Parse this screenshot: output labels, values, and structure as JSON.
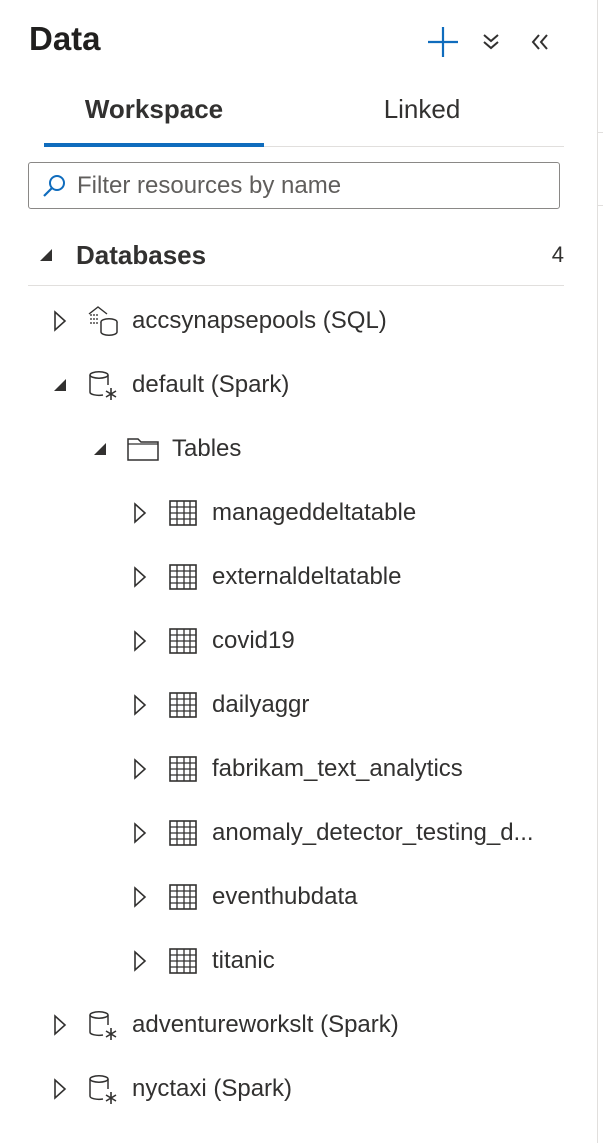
{
  "header": {
    "title": "Data"
  },
  "tabs": [
    {
      "label": "Workspace",
      "active": true
    },
    {
      "label": "Linked",
      "active": false
    }
  ],
  "search": {
    "placeholder": "Filter resources by name",
    "value": ""
  },
  "section": {
    "label": "Databases",
    "count": "4",
    "expanded": true
  },
  "tree": [
    {
      "label": "accsynapsepools (SQL)",
      "icon": "sql-pool-icon",
      "expanded": false
    },
    {
      "label": "default (Spark)",
      "icon": "spark-database-icon",
      "expanded": true
    },
    {
      "label": "Tables",
      "icon": "folder-icon",
      "expanded": true
    },
    {
      "label": "manageddeltatable",
      "icon": "table-icon",
      "expanded": false
    },
    {
      "label": "externaldeltatable",
      "icon": "table-icon",
      "expanded": false
    },
    {
      "label": "covid19",
      "icon": "table-icon",
      "expanded": false
    },
    {
      "label": "dailyaggr",
      "icon": "table-icon",
      "expanded": false
    },
    {
      "label": "fabrikam_text_analytics",
      "icon": "table-icon",
      "expanded": false
    },
    {
      "label": "anomaly_detector_testing_d...",
      "icon": "table-icon",
      "expanded": false
    },
    {
      "label": "eventhubdata",
      "icon": "table-icon",
      "expanded": false
    },
    {
      "label": "titanic",
      "icon": "table-icon",
      "expanded": false
    },
    {
      "label": "adventureworkslt (Spark)",
      "icon": "spark-database-icon",
      "expanded": false
    },
    {
      "label": "nyctaxi (Spark)",
      "icon": "spark-database-icon",
      "expanded": false
    }
  ],
  "colors": {
    "accent": "#0f6cbd",
    "text": "#323130",
    "divider": "#e1dfdd"
  }
}
